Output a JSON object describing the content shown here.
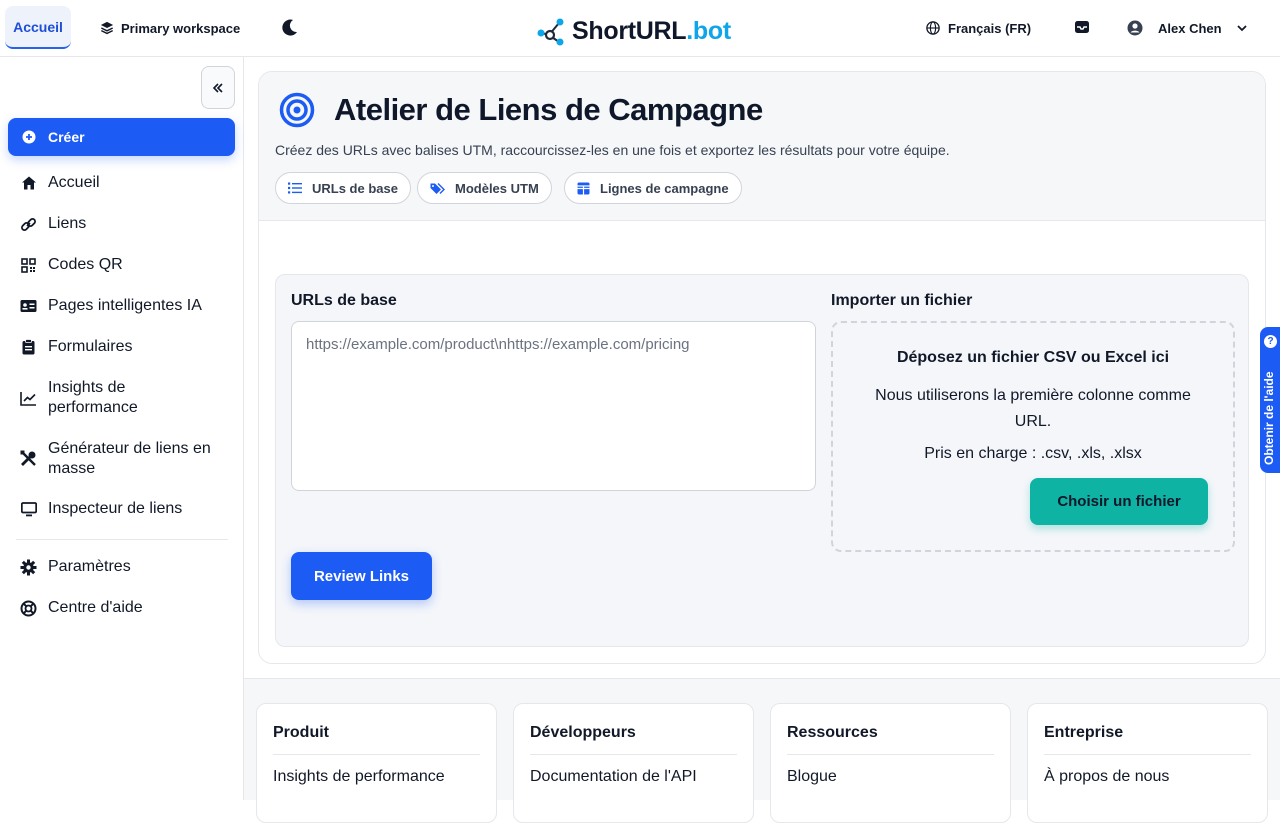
{
  "topbar": {
    "home_tab": "Accueil",
    "workspace": "Primary workspace",
    "brand": {
      "main": "ShortURL",
      "suffix": ".bot"
    },
    "language": "Français (FR)",
    "user": "Alex Chen"
  },
  "sidebar": {
    "create": "Créer",
    "items": [
      {
        "label": "Accueil",
        "icon": "home-icon"
      },
      {
        "label": "Liens",
        "icon": "link-icon"
      },
      {
        "label": "Codes QR",
        "icon": "qr-code-icon"
      },
      {
        "label": "Pages intelligentes IA",
        "icon": "id-card-icon"
      },
      {
        "label": "Formulaires",
        "icon": "clipboard-icon"
      },
      {
        "label": "Insights de performance",
        "icon": "chart-line-icon"
      },
      {
        "label": "Générateur de liens en masse",
        "icon": "tools-icon"
      },
      {
        "label": "Inspecteur de liens",
        "icon": "monitor-icon"
      }
    ],
    "bottom_items": [
      {
        "label": "Paramètres",
        "icon": "gear-icon"
      },
      {
        "label": "Centre d'aide",
        "icon": "lifebuoy-icon"
      }
    ]
  },
  "main": {
    "title": "Atelier de Liens de Campagne",
    "subtitle": "Créez des URLs avec balises UTM, raccourcissez-les en une fois et exportez les résultats pour votre équipe.",
    "pills": [
      "URLs de base",
      "Modèles UTM",
      "Lignes de campagne"
    ],
    "base_urls_label": "URLs de base",
    "base_urls_placeholder": "https://example.com/product\\nhttps://example.com/pricing",
    "import_label": "Importer un fichier",
    "dropzone_title": "Déposez un fichier CSV ou Excel ici",
    "dropzone_desc": "Nous utiliserons la première colonne comme URL.",
    "dropzone_formats": "Pris en charge : .csv, .xls, .xlsx",
    "choose_file": "Choisir un fichier",
    "review": "Review Links"
  },
  "help_tab": "Obtenir de l'aide",
  "footer": [
    {
      "heading": "Produit",
      "link": "Insights de performance"
    },
    {
      "heading": "Développeurs",
      "link": "Documentation de l'API"
    },
    {
      "heading": "Ressources",
      "link": "Blogue"
    },
    {
      "heading": "Entreprise",
      "link": "À propos de nous"
    }
  ],
  "colors": {
    "accent": "#1d5bf5",
    "teal": "#0fb3a3",
    "brand_dot": "#0ea5e9"
  }
}
